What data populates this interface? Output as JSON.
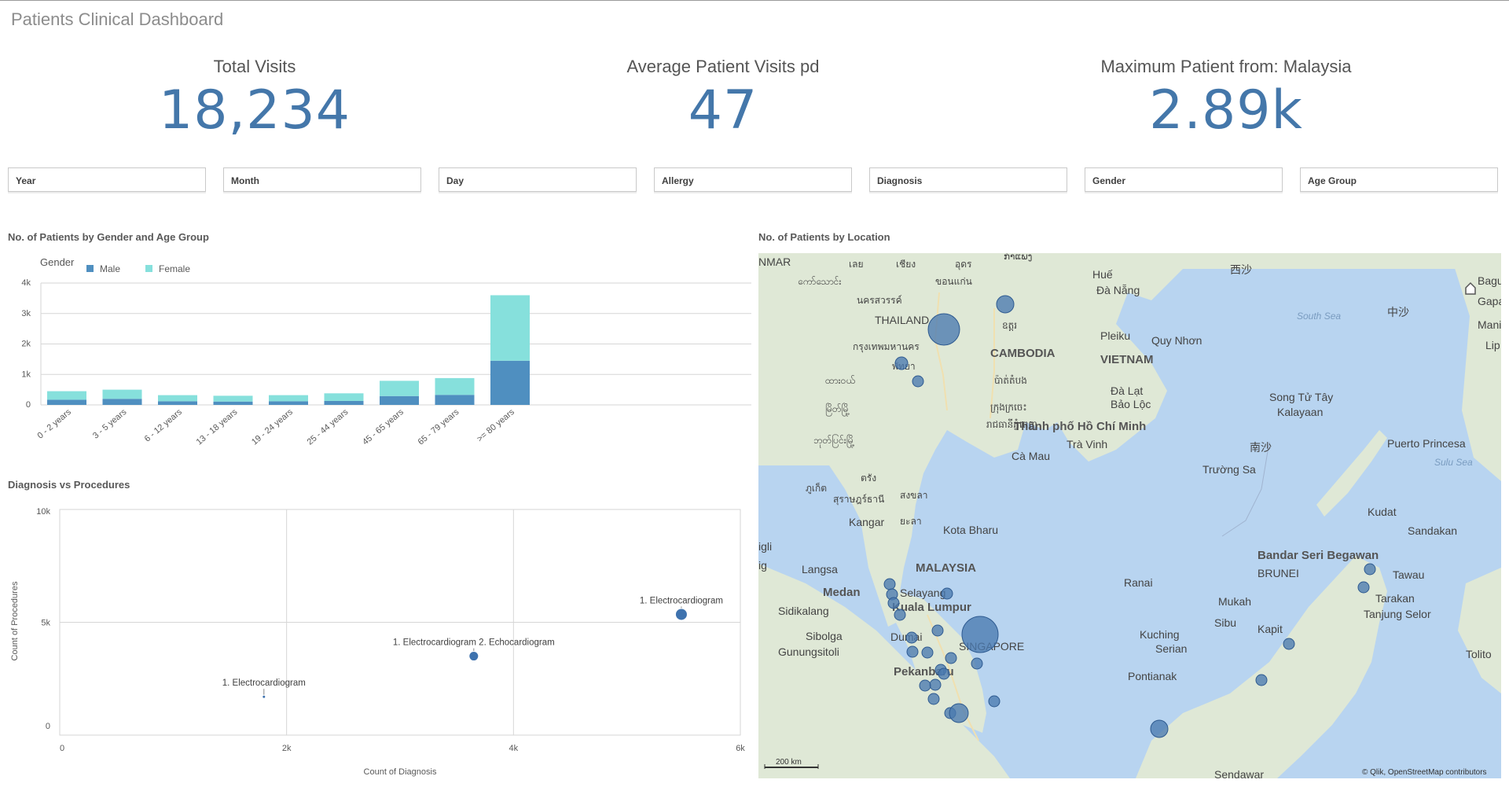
{
  "app": {
    "title": "Patients Clinical Dashboard"
  },
  "kpis": [
    {
      "label": "Total Visits",
      "value": "18,234"
    },
    {
      "label": "Average Patient Visits pd",
      "value": "47"
    },
    {
      "label": "Maximum Patient from: Malaysia",
      "value": "2.89k"
    }
  ],
  "filters": [
    "Year",
    "Month",
    "Day",
    "Allergy",
    "Diagnosis",
    "Gender",
    "Age Group"
  ],
  "bar_panel": {
    "title": "No. of Patients by Gender and Age Group",
    "legend_title": "Gender"
  },
  "scatter_panel": {
    "title": "Diagnosis vs Procedures"
  },
  "map_panel": {
    "title": "No. of Patients by Location",
    "scale": "200 km",
    "attribution": "© Qlik, OpenStreetMap contributors",
    "labels": [
      "NMAR",
      "THAILAND",
      "CAMBODIA",
      "VIETNAM",
      "MALAYSIA",
      "SINGAPORE",
      "BRUNEI",
      "South Sea",
      "Sulu Sea",
      "Đà Nẵng",
      "Huế",
      "Pleiku",
      "Quy Nhơn",
      "Đà Lạt",
      "Bảo Lộc",
      "Thành phố Hồ Chí Minh",
      "Trà Vinh",
      "Cà Mau",
      "Song Tử Tây",
      "Kalayaan",
      "Puerto Princesa",
      "Trường Sa",
      "Kota Bharu",
      "Kangar",
      "Langsa",
      "Medan",
      "Selayang",
      "Kuala Lumpur",
      "Sidikalang",
      "Sibolga",
      "Gunungsitoli",
      "Dumai",
      "Pekanbaru",
      "Ranai",
      "Bandar Seri Begawan",
      "Sandakan",
      "Tawau",
      "Tarakan",
      "Tanjung Selor",
      "Mukah",
      "Sibu",
      "Kapit",
      "Kuching",
      "Serian",
      "Pontianak",
      "Kudat",
      "Baguio",
      "Gapa",
      "Mani",
      "Lip",
      "Tolito",
      "igli",
      "ig",
      "Sendawar",
      "西沙",
      "中沙",
      "南沙",
      "ກຳແພງ",
      "ขอนแก่น",
      "นครสวรรค์",
      "กรุงเทพมหานคร",
      "พัทยา",
      "สุราษฎร์ธานี",
      "ภูเก็ต",
      "ตรัง",
      "สงขลา",
      "ยะลา",
      "ကော်သောင်း",
      "ထားဝယ်",
      "မြိတ်မြို့",
      "ဘုတ်ပြင်းမြို့",
      "ប៉ាត់តំបង",
      "ក្រុងក្រចេះ",
      "រាជធានីភ្នំពេញ",
      "ឧត្តរ",
      "อุดร",
      "เลย",
      "เชียง"
    ]
  },
  "chart_data": [
    {
      "type": "bar",
      "stacked": true,
      "title": "No. of Patients by Gender and Age Group",
      "categories": [
        "0 - 2 years",
        "3 - 5 years",
        "6 - 12 years",
        "13 - 18 years",
        "19 - 24 years",
        "25 - 44 years",
        "45 - 65 years",
        "65 - 79 years",
        ">= 80 years"
      ],
      "series": [
        {
          "name": "Male",
          "color": "#4f8fc0",
          "values": [
            170,
            200,
            120,
            110,
            120,
            130,
            290,
            330,
            1450
          ]
        },
        {
          "name": "Female",
          "color": "#86e0dc",
          "values": [
            280,
            300,
            200,
            190,
            200,
            250,
            500,
            550,
            2150
          ]
        }
      ],
      "yticks": [
        "0",
        "1k",
        "2k",
        "3k",
        "4k"
      ],
      "ylim": [
        0,
        4000
      ],
      "legend": "top-left",
      "grid": true
    },
    {
      "type": "scatter",
      "title": "Diagnosis vs Procedures",
      "xlabel": "Count of Diagnosis",
      "ylabel": "Count of Procedures",
      "xticks": [
        "0",
        "2k",
        "4k",
        "6k"
      ],
      "yticks": [
        "0",
        "5k",
        "10k"
      ],
      "xlim": [
        0,
        6000
      ],
      "ylim": [
        0,
        10000
      ],
      "points": [
        {
          "label": "1. Electrocardiogram",
          "x": 1800,
          "y": 1700,
          "size": 1
        },
        {
          "label": "1. Electrocardiogram 2. Echocardiogram",
          "x": 3650,
          "y": 3500,
          "size": 3
        },
        {
          "label": "1. Electrocardiogram",
          "x": 5480,
          "y": 5350,
          "size": 4
        }
      ],
      "grid": true
    }
  ]
}
